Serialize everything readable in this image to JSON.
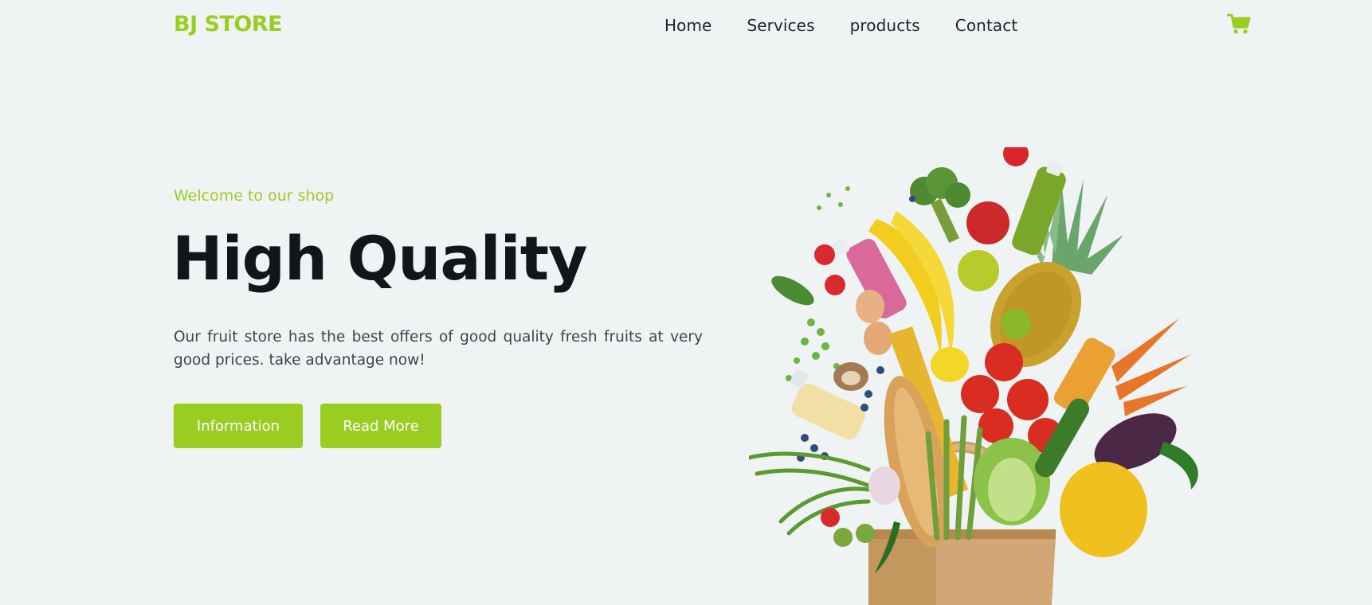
{
  "brand": {
    "logo_text": "BJ STORE"
  },
  "nav": {
    "items": [
      {
        "label": "Home"
      },
      {
        "label": "Services"
      },
      {
        "label": "products"
      },
      {
        "label": "Contact"
      }
    ]
  },
  "header": {
    "cart_icon": "shopping-cart-icon"
  },
  "hero": {
    "eyebrow": "Welcome to our shop",
    "title": "High Quality",
    "description": "Our fruit store has the best offers of good quality fresh fruits at very good prices. take advantage now!",
    "buttons": {
      "information": "Information",
      "read_more": "Read More"
    },
    "image": "grocery-bag-with-fruits-and-vegetables"
  },
  "colors": {
    "accent": "#9acd22",
    "background": "#eff3f4",
    "heading": "#11161b",
    "body_text": "#3e4448"
  }
}
